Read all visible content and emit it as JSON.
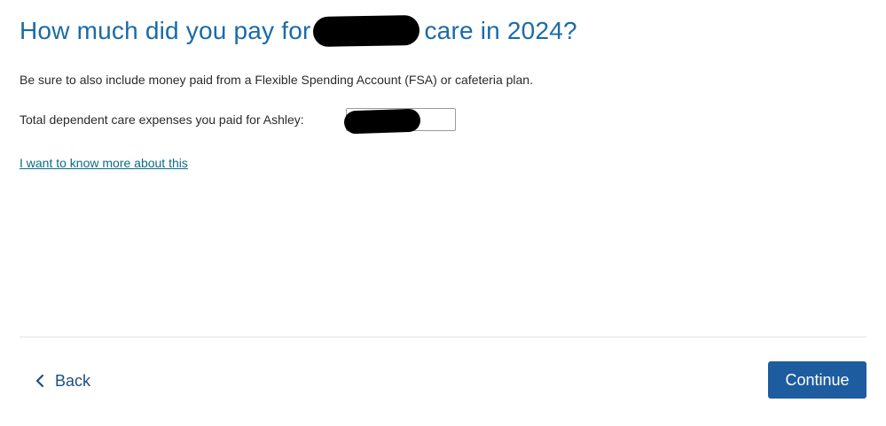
{
  "question": {
    "title_before": "How much did you pay for",
    "title_after": "care in 2024?",
    "instruction": "Be sure to also include money paid from a Flexible Spending Account (FSA) or cafeteria plan."
  },
  "expense_field": {
    "label": "Total dependent care expenses you paid for Ashley:",
    "value": ""
  },
  "help_link": {
    "label": "I want to know more about this"
  },
  "navigation": {
    "back_label": "Back",
    "continue_label": "Continue"
  },
  "colors": {
    "title": "#1a6ba8",
    "link": "#0a6c85",
    "primary_button": "#1d5c9e",
    "back_text": "#1a4e86"
  },
  "icons": {
    "back": "chevron-left-icon"
  }
}
